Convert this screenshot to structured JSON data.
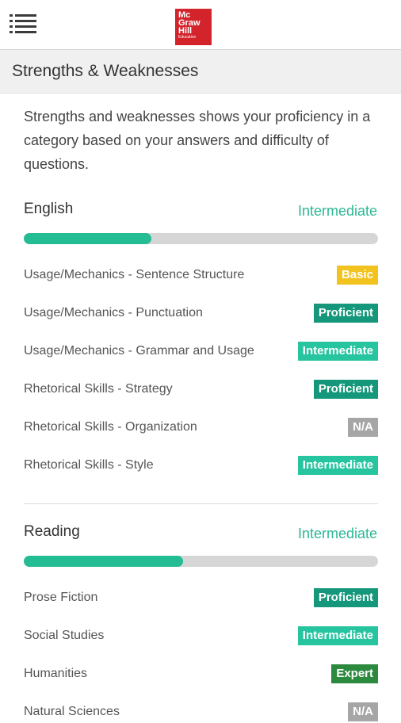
{
  "header": {
    "menu_icon": "hamburger-menu-icon",
    "logo_lines": [
      "Mc",
      "Graw",
      "Hill",
      "Education"
    ],
    "brand_color": "#d3242c"
  },
  "page": {
    "title": "Strengths & Weaknesses",
    "intro": "Strengths and weaknesses shows your proficiency in a category based on your answers and difficulty of questions."
  },
  "subjects": [
    {
      "name": "English",
      "level": "Intermediate",
      "progress": 0.36,
      "categories": [
        {
          "label": "Usage/Mechanics - Sentence Structure",
          "level": "Basic"
        },
        {
          "label": "Usage/Mechanics - Punctuation",
          "level": "Proficient"
        },
        {
          "label": "Usage/Mechanics - Grammar and Usage",
          "level": "Intermediate"
        },
        {
          "label": "Rhetorical Skills - Strategy",
          "level": "Proficient"
        },
        {
          "label": "Rhetorical Skills - Organization",
          "level": "N/A"
        },
        {
          "label": "Rhetorical Skills - Style",
          "level": "Intermediate"
        }
      ]
    },
    {
      "name": "Reading",
      "level": "Intermediate",
      "progress": 0.45,
      "categories": [
        {
          "label": "Prose Fiction",
          "level": "Proficient"
        },
        {
          "label": "Social Studies",
          "level": "Intermediate"
        },
        {
          "label": "Humanities",
          "level": "Expert"
        },
        {
          "label": "Natural Sciences",
          "level": "N/A"
        }
      ]
    }
  ],
  "colors": {
    "accent": "#24bc93",
    "basic": "#f2c21e",
    "proficient": "#14977a",
    "intermediate": "#27c4a0",
    "na": "#a6a6a6",
    "expert": "#2c8a3f"
  }
}
